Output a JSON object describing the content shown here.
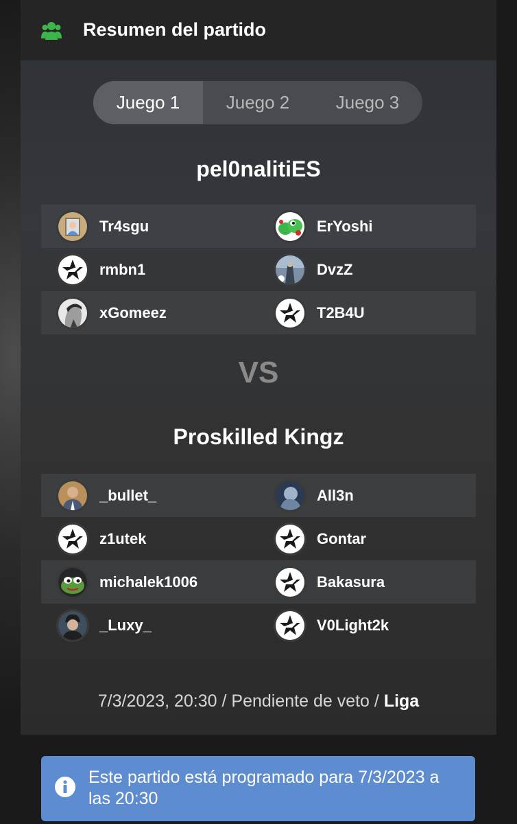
{
  "header": {
    "title": "Resumen del partido",
    "icon": "users-icon",
    "icon_color": "#3cb54a"
  },
  "tabs": [
    {
      "label": "Juego 1",
      "active": true
    },
    {
      "label": "Juego 2",
      "active": false
    },
    {
      "label": "Juego 3",
      "active": false
    }
  ],
  "team1": {
    "name": "pel0nalitiES",
    "players": [
      {
        "name": "Tr4sgu",
        "avatar": "photo"
      },
      {
        "name": "ErYoshi",
        "avatar": "yoshi"
      },
      {
        "name": "rmbn1",
        "avatar": "star-logo"
      },
      {
        "name": "DvzZ",
        "avatar": "photo"
      },
      {
        "name": "xGomeez",
        "avatar": "photo"
      },
      {
        "name": "T2B4U",
        "avatar": "star-logo"
      }
    ]
  },
  "versus": "VS",
  "team2": {
    "name": "Proskilled Kingz",
    "players": [
      {
        "name": "_bullet_",
        "avatar": "photo"
      },
      {
        "name": "All3n",
        "avatar": "photo"
      },
      {
        "name": "z1utek",
        "avatar": "star-logo"
      },
      {
        "name": "Gontar",
        "avatar": "star-logo"
      },
      {
        "name": "michalek1006",
        "avatar": "frog"
      },
      {
        "name": "Bakasura",
        "avatar": "star-logo"
      },
      {
        "name": "_Luxy_",
        "avatar": "photo"
      },
      {
        "name": "V0Light2k",
        "avatar": "star-logo"
      }
    ]
  },
  "meta": {
    "datetime": "7/3/2023, 20:30",
    "separator1": " / ",
    "status": "Pendiente de veto",
    "separator2": " / ",
    "competition": "Liga"
  },
  "notice": {
    "text": "Este partido está programado para 7/3/2023 a las 20:30",
    "icon": "info-icon",
    "color": "#5e8cd1"
  }
}
